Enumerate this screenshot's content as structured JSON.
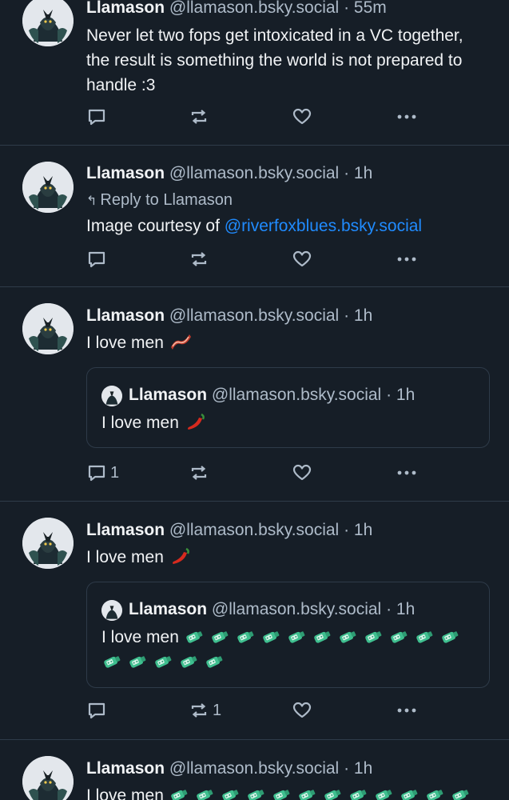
{
  "colors": {
    "background": "#161e27",
    "text": "#f1f3f5",
    "muted": "#aebbc9",
    "link": "#208bfe",
    "divider": "#2e3b49"
  },
  "posts": [
    {
      "author": "Llamason",
      "handle": "@llamason.bsky.social",
      "separator": "·",
      "time": "55m",
      "text": "Never let two fops get intoxicated in a VC together, the result is something the world is not prepared to handle :3",
      "reply_count": "",
      "repost_count": ""
    },
    {
      "author": "Llamason",
      "handle": "@llamason.bsky.social",
      "separator": "·",
      "time": "1h",
      "reply_to": "Reply to Llamason",
      "text": "Image courtesy of ",
      "mention": "@riverfoxblues.bsky.social",
      "reply_count": "",
      "repost_count": ""
    },
    {
      "author": "Llamason",
      "handle": "@llamason.bsky.social",
      "separator": "·",
      "time": "1h",
      "text": "I love men",
      "emoji": "bacon",
      "quote": {
        "author": "Llamason",
        "handle": "@llamason.bsky.social",
        "separator": "·",
        "time": "1h",
        "text": "I love men",
        "emoji": "hot-pepper"
      },
      "reply_count": "1",
      "repost_count": ""
    },
    {
      "author": "Llamason",
      "handle": "@llamason.bsky.social",
      "separator": "·",
      "time": "1h",
      "text": "I love men",
      "emoji": "hot-pepper",
      "quote": {
        "author": "Llamason",
        "handle": "@llamason.bsky.social",
        "separator": "·",
        "time": "1h",
        "text": "I love men",
        "emoji": "bottle",
        "emoji_count": 16
      },
      "reply_count": "",
      "repost_count": "1"
    },
    {
      "author": "Llamason",
      "handle": "@llamason.bsky.social",
      "separator": "·",
      "time": "1h",
      "text": "I love men",
      "emoji": "bottle"
    }
  ]
}
